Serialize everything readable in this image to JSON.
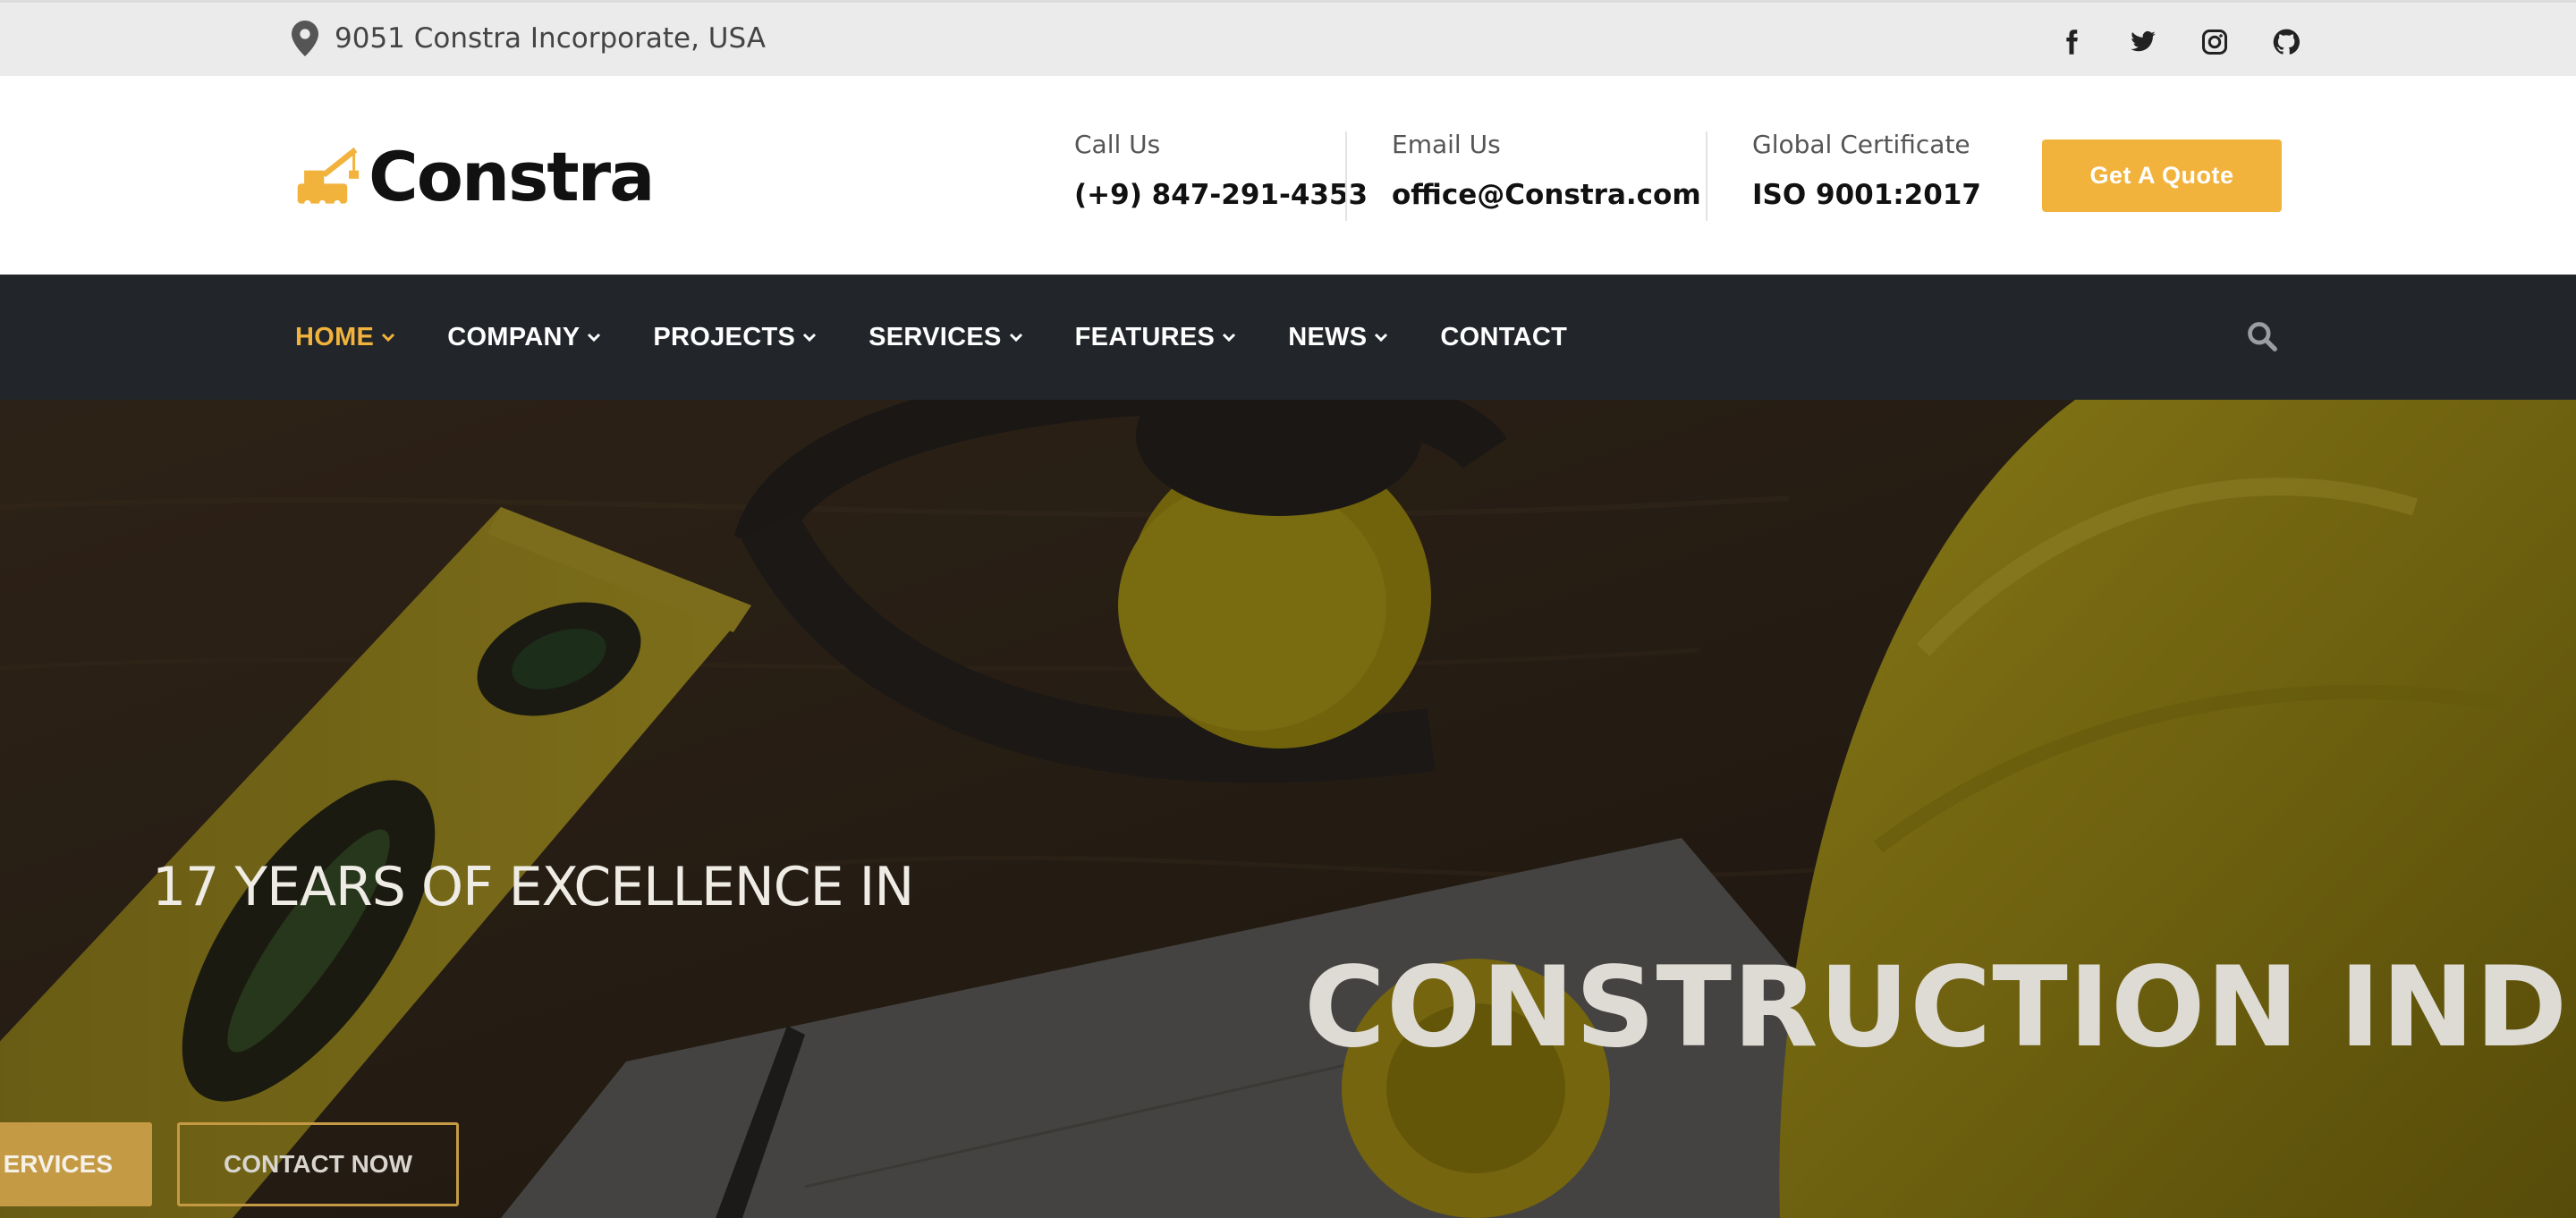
{
  "topbar": {
    "address": "9051 Constra Incorporate, USA",
    "social": [
      "facebook-icon",
      "twitter-icon",
      "instagram-icon",
      "github-icon"
    ]
  },
  "header": {
    "logo_text": "Constra",
    "call": {
      "label": "Call Us",
      "value": "(+9) 847-291-4353"
    },
    "email": {
      "label": "Email Us",
      "value": "office@Constra.com"
    },
    "certificate": {
      "label": "Global Certificate",
      "value": "ISO 9001:2017"
    },
    "quote_button": "Get A Quote"
  },
  "nav": {
    "items": [
      {
        "label": "HOME",
        "dropdown": true
      },
      {
        "label": "COMPANY",
        "dropdown": true
      },
      {
        "label": "PROJECTS",
        "dropdown": true
      },
      {
        "label": "SERVICES",
        "dropdown": true
      },
      {
        "label": "FEATURES",
        "dropdown": true
      },
      {
        "label": "NEWS",
        "dropdown": true
      },
      {
        "label": "CONTACT",
        "dropdown": false
      }
    ]
  },
  "hero": {
    "subtitle": "17 YEARS OF EXCELLENCE IN",
    "title": "CONSTRUCTION INDUS",
    "btn_services": "ERVICES",
    "btn_contact": "CONTACT NOW"
  },
  "colors": {
    "accent": "#f2b33d",
    "nav_bg": "#22262b",
    "topbar_bg": "#ebebeb"
  }
}
